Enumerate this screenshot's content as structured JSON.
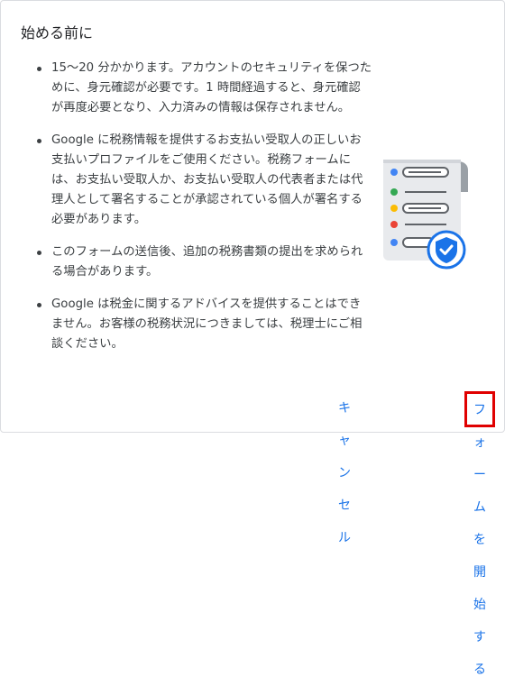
{
  "dialog": {
    "title": "始める前に",
    "bullets": [
      "15〜20 分かかります。アカウントのセキュリティを保つために、身元確認が必要です。1 時間経過すると、身元確認が再度必要となり、入力済みの情報は保存されません。",
      "Google に税務情報を提供するお支払い受取人の正しいお支払いプロファイルをご使用ください。税務フォームには、お支払い受取人か、お支払い受取人の代表者または代理人として署名することが承認されている個人が署名する必要があります。",
      "このフォームの送信後、追加の税務書類の提出を求められる場合があります。",
      "Google は税金に関するアドバイスを提供することはできません。お客様の税務状況につきましては、税理士にご相談ください。"
    ],
    "illustration_icon": "tax-document-verified-icon",
    "cancel_label": "キャンセル",
    "start_label": "フォームを開始する"
  },
  "colors": {
    "accent": "#1a73e8",
    "highlight_box": "#e00000",
    "dot_blue": "#4285f4",
    "dot_green": "#34a853",
    "dot_yellow": "#fbbc04",
    "dot_red": "#ea4335"
  }
}
